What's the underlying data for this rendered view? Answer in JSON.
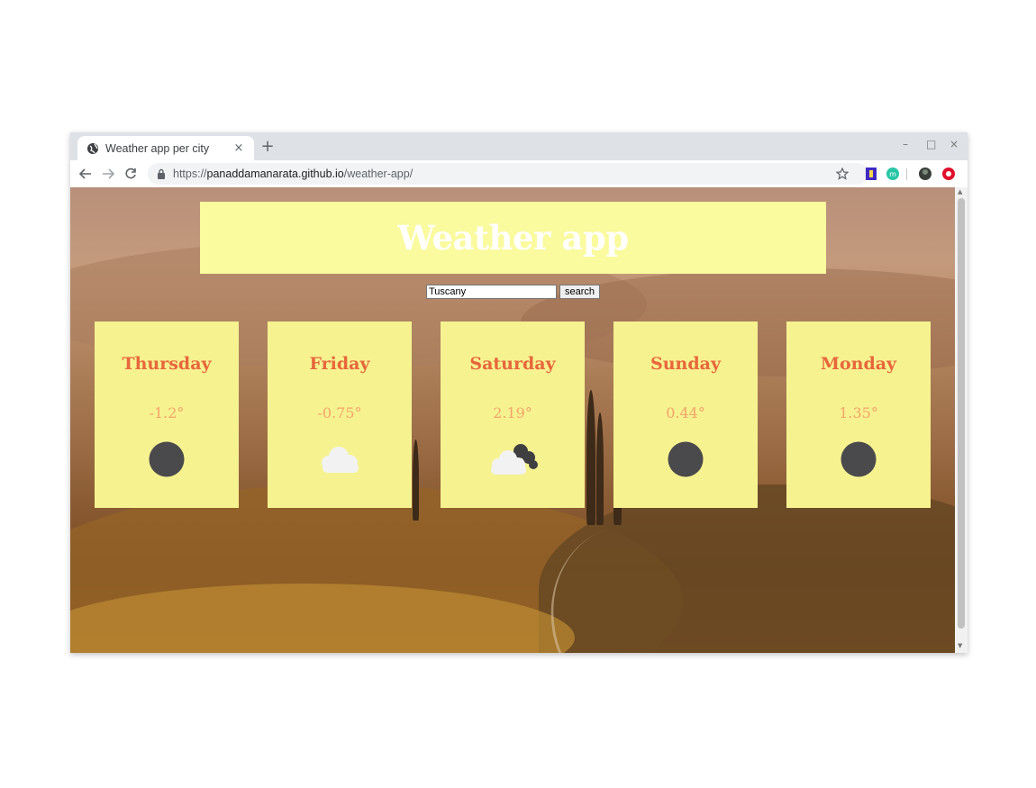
{
  "browser": {
    "tab_title": "Weather app per city",
    "tab_close": "×",
    "new_tab": "+",
    "url_scheme": "https://",
    "url_host": "panaddamanarata.github.io",
    "url_path": "/weather-app/",
    "window_minimize": "–",
    "window_maximize": "□",
    "window_close": "×"
  },
  "header": {
    "title": "Weather app"
  },
  "search": {
    "value": "Tuscany",
    "button_label": "search"
  },
  "forecast": [
    {
      "day": "Thursday",
      "temp": "-1.2°",
      "icon": "dark-circle-icon"
    },
    {
      "day": "Friday",
      "temp": "-0.75°",
      "icon": "cloud-icon"
    },
    {
      "day": "Saturday",
      "temp": "2.19°",
      "icon": "broken-clouds-icon"
    },
    {
      "day": "Sunday",
      "temp": "0.44°",
      "icon": "dark-circle-icon"
    },
    {
      "day": "Monday",
      "temp": "1.35°",
      "icon": "dark-circle-icon"
    }
  ],
  "colors": {
    "banner_bg": "#fafa9e",
    "card_bg": "#f6f290",
    "day_text": "#e8663c",
    "temp_text": "#f4a46a"
  }
}
